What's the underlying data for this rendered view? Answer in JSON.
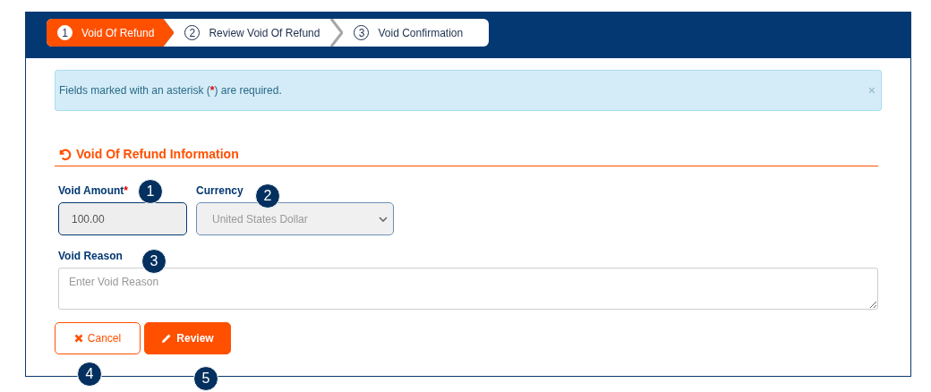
{
  "steps": [
    {
      "number": "1",
      "label": "Void Of Refund",
      "selected": true
    },
    {
      "number": "2",
      "label": "Review Void Of Refund",
      "selected": false
    },
    {
      "number": "3",
      "label": "Void Confirmation",
      "selected": false
    }
  ],
  "alert": {
    "text_before": "Fields marked with an asterisk (",
    "mark": "*",
    "text_after": ") are required.",
    "close": "×"
  },
  "section": {
    "title": "Void Of Refund Information"
  },
  "fields": {
    "amount": {
      "label": "Void Amount",
      "required": true,
      "value": "100.00"
    },
    "currency": {
      "label": "Currency",
      "value": "United States Dollar",
      "disabled": true
    },
    "reason": {
      "label": "Void Reason",
      "placeholder": "Enter Void Reason"
    }
  },
  "buttons": [
    {
      "kind": "cancel",
      "label": "Cancel"
    },
    {
      "kind": "review",
      "label": "Review"
    }
  ],
  "callouts": [
    "1",
    "2",
    "3",
    "4",
    "5"
  ]
}
